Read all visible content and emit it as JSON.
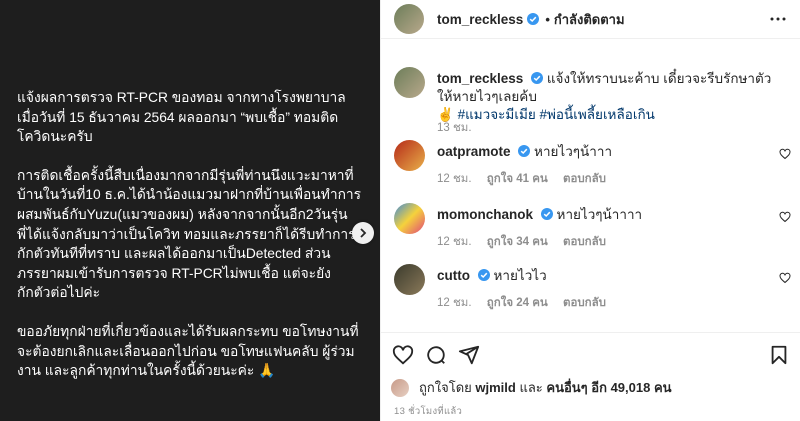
{
  "post_image": {
    "paragraphs": [
      "แจ้งผลการตรวจ RT-PCR ของทอม จากทางโรงพยาบาล\nเมื่อวันที่ 15 ธันวาคม 2564 ผลออกมา “พบเชื้อ” ทอมติด\nโควิดนะครับ",
      "การติดเชื้อครั้งนี้สืบเนื่องมากจากมีรุ่นพี่ท่านนึงแวะมาหาที่\nบ้านในวันที่10 ธ.ค.ได้นำน้องแมวมาฝากที่บ้านเพื่อนทำการ\nผสมพันธ์กับYuzu(แมวของผม) หลังจากจากนั้นอีก2วันรุ่น\nพี่ได้แจ้งกลับมาว่าเป็นโควิท ทอมและภรรยาก็ได้รีบทำการ\nกักตัวทันทีที่ทราบ และผลได้ออกมาเป็นDetected ส่วน\nภรรยาผมเข้ารับการตรวจ RT-PCRไม่พบเชื้อ แต่จะยัง\nกักตัวต่อไปค่ะ",
      "ขออภัยทุกฝ่ายที่เกี่ยวข้องและได้รับผลกระทบ ขอโทษงานที่\nจะต้องยกเลิกและเลื่อนออกไปก่อน ขอโทษแฟนคลับ ผู้ร่วม\nงาน และลูกค้าทุกท่านในครั้งนี้ด้วยนะค่ะ 🙏"
    ]
  },
  "header": {
    "username": "tom_reckless",
    "separator": "•",
    "follow_status": "กำลังติดตาม"
  },
  "caption": {
    "username": "tom_reckless",
    "text": "แจ้งให้ทราบนะค้าบ เดี๋ยวจะรีบรักษาตัวให้หายไวๆเลยค้บ",
    "emoji": "✌️",
    "hashtags": "#แมวจะมีเมีย #พ่อนี้เพลี้ยเหลือเกิน",
    "time": "13 ชม."
  },
  "comments": [
    {
      "username": "oatpramote",
      "text": "หายไวๆน้าาา",
      "time": "12 ชม.",
      "likes": "ถูกใจ 41 คน",
      "reply": "ตอบกลับ"
    },
    {
      "username": "momonchanok",
      "text": "หายไวๆน้าาาา",
      "time": "12 ชม.",
      "likes": "ถูกใจ 34 คน",
      "reply": "ตอบกลับ"
    },
    {
      "username": "cutto",
      "text": "หายไวไว",
      "time": "12 ชม.",
      "likes": "ถูกใจ 24 คน",
      "reply": "ตอบกลับ"
    }
  ],
  "likes": {
    "prefix": "ถูกใจโดย",
    "user": "wjmild",
    "and": "และ",
    "others": "คนอื่นๆ อีก 49,018 คน"
  },
  "time_ago": "13 ชั่วโมงที่แล้ว",
  "icons": {
    "verified": "verified-badge-icon",
    "more": "more-options-icon",
    "heart": "heart-icon",
    "comment": "comment-icon",
    "share": "share-icon",
    "save": "bookmark-icon",
    "next": "chevron-right-icon"
  },
  "colors": {
    "verified": "#3897f0",
    "image_bg": "#1e1e1e",
    "hashtag": "#00376b",
    "muted": "#8e8e8e"
  }
}
